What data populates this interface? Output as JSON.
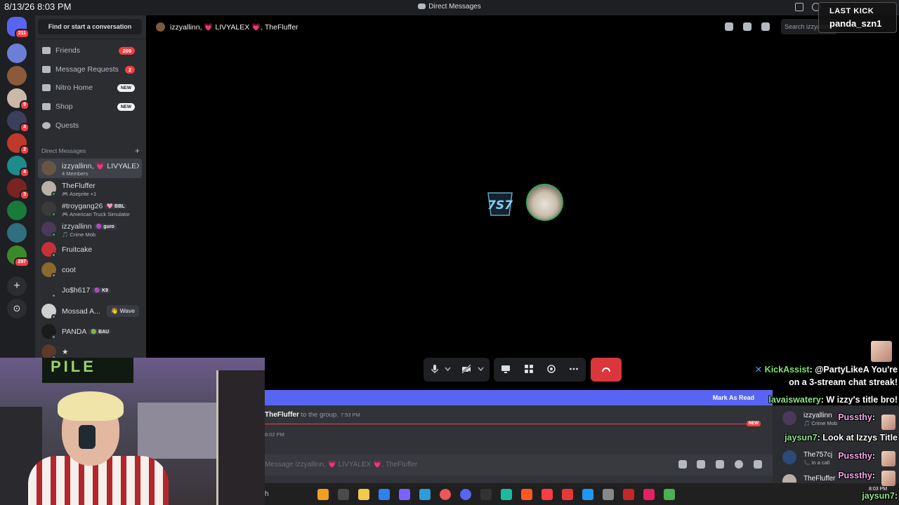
{
  "titlebar": {
    "clock": "8/13/26 8:03 PM",
    "window_title": "Direct Messages"
  },
  "rail": {
    "home_badge": "211",
    "servers": [
      {
        "color": "#6b7fd7",
        "badge": ""
      },
      {
        "color": "#8b5a3c",
        "badge": ""
      },
      {
        "color": "#c9b9a6",
        "badge": "9"
      },
      {
        "color": "#3b3f5c",
        "badge": "4"
      },
      {
        "color": "#c03a2b",
        "badge": "2"
      },
      {
        "color": "#1f8b8b",
        "badge": "4"
      },
      {
        "color": "#7a2323",
        "badge": "3"
      },
      {
        "color": "#1a7a3a",
        "badge": ""
      },
      {
        "color": "#2f6f7f",
        "badge": ""
      },
      {
        "color": "#3a8a2a",
        "badge": "297"
      }
    ]
  },
  "sidebar": {
    "find_label": "Find or start a conversation",
    "nav": [
      {
        "label": "Friends",
        "count": "209",
        "pill": ""
      },
      {
        "label": "Message Requests",
        "count": "2",
        "pill": ""
      },
      {
        "label": "Nitro Home",
        "count": "",
        "pill": "NEW"
      },
      {
        "label": "Shop",
        "count": "",
        "pill": "NEW"
      },
      {
        "label": "Quests",
        "count": "",
        "pill": ""
      }
    ],
    "dm_header": "Direct Messages",
    "dms": [
      {
        "name": "izzyallinn, 💗 LIVYALEX 💗, TheFluffer",
        "sub": "4 Members",
        "tag": "",
        "wave": "",
        "color": "#6a5544"
      },
      {
        "name": "TheFluffer",
        "sub": "🎮 Aseprite +1",
        "tag": "",
        "wave": "",
        "color": "#b9b0a8"
      },
      {
        "name": "#troygang26",
        "sub": "🎮 American Truck Simulator",
        "tag": "🩷 BBL",
        "wave": "",
        "color": "#3a3a3a"
      },
      {
        "name": "izzyallinn",
        "sub": "🎵 Crime Mob",
        "tag": "🟣 guro",
        "wave": "",
        "color": "#4a3a5a"
      },
      {
        "name": "Fruitcake",
        "sub": "",
        "tag": "",
        "wave": "",
        "color": "#c5303a"
      },
      {
        "name": "coot",
        "sub": "",
        "tag": "",
        "wave": "",
        "color": "#8a6a2a"
      },
      {
        "name": "Jo$h617",
        "sub": "",
        "tag": "🟣 K9",
        "wave": "",
        "color": "#2d2d2d"
      },
      {
        "name": "Mossad A...",
        "sub": "",
        "tag": "",
        "wave": "👋 Wave",
        "color": "#d0d0d0"
      },
      {
        "name": "PANDA",
        "sub": "",
        "tag": "🟢 BAU",
        "wave": "",
        "color": "#1a1a1a"
      },
      {
        "name": "★",
        "sub": "",
        "tag": "",
        "wave": "",
        "color": "#5a3a2a"
      }
    ]
  },
  "call": {
    "header_title": "izzyallinn, 💗 LIVYALEX 💗, TheFluffer",
    "search_placeholder": "Search izzyallinn"
  },
  "chat": {
    "mark_as_read": "Mark As Read",
    "system_line_user": "TheFluffer",
    "system_line_text": " to the group.",
    "system_line_time": "7:53 PM",
    "second_time": "8:02 PM",
    "new_label": "NEW",
    "composer_placeholder": "Message izzyallinn, 💗 LIVYALEX 💗, TheFluffer"
  },
  "members": [
    {
      "name": "izzyallinn",
      "status": "🎵 Crime Mob",
      "color": "#4a3a5a"
    },
    {
      "name": "The757cj",
      "status": "📞 In a call",
      "color": "#2a4a7a"
    },
    {
      "name": "TheFluffer",
      "status": "",
      "color": "#b9b0a8"
    }
  ],
  "overlay": {
    "last_kick_label": "LAST KICK",
    "last_kick_user": "panda_szn1",
    "chat_lines": [
      {
        "user": "KickAssist",
        "msg": ": @PartyLikeA You're",
        "cls": "u"
      },
      {
        "user": "",
        "msg": "on a 3-stream chat streak!",
        "cls": ""
      },
      {
        "user": "lavaiswatery",
        "msg": ": W izzy's title bro!",
        "cls": "u2"
      },
      {
        "user": "Pussthy",
        "msg": ":",
        "cls": "u3"
      },
      {
        "user": "jaysun7",
        "msg": ": Look at Izzys Title",
        "cls": "u2"
      },
      {
        "user": "Pussthy",
        "msg": ":",
        "cls": "u3"
      },
      {
        "user": "Pussthy",
        "msg": ":",
        "cls": "u3"
      },
      {
        "user": "jaysun7",
        "msg": ":",
        "cls": "u2"
      }
    ],
    "webcam_banner": "PILE"
  },
  "taskbar": {
    "time": "8:03 PM",
    "search_fragment": "h"
  }
}
